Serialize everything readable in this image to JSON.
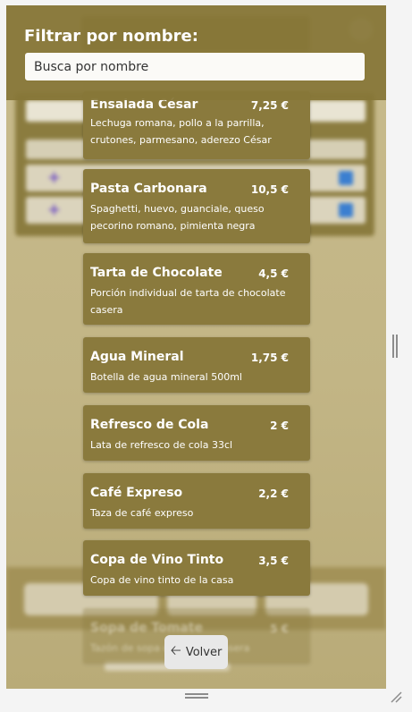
{
  "filter": {
    "label": "Filtrar por nombre:",
    "placeholder": "Busca por nombre",
    "value": ""
  },
  "menu_items": [
    {
      "name": "Ensalada César",
      "price": "7,25 €",
      "description": "Lechuga romana, pollo a la parrilla, crutones, parmesano, aderezo César"
    },
    {
      "name": "Pasta Carbonara",
      "price": "10,5 €",
      "description": "Spaghetti, huevo, guanciale, queso pecorino romano, pimienta negra"
    },
    {
      "name": "Tarta de Chocolate",
      "price": "4,5 €",
      "description": "Porción individual de tarta de chocolate casera"
    },
    {
      "name": "Agua Mineral",
      "price": "1,75 €",
      "description": "Botella de agua mineral 500ml"
    },
    {
      "name": "Refresco de Cola",
      "price": "2 €",
      "description": "Lata de refresco de cola 33cl"
    },
    {
      "name": "Café Expreso",
      "price": "2,2 €",
      "description": "Taza de café expreso"
    },
    {
      "name": "Copa de Vino Tinto",
      "price": "3,5 €",
      "description": "Copa de vino tinto de la casa"
    },
    {
      "name": "Sopa de Tomate",
      "price": "5 €",
      "description": "Tazón de sopa de tomate casera"
    }
  ],
  "back_button": {
    "label": "Volver",
    "icon": "arrow-left-icon"
  },
  "colors": {
    "card": "#8a7a3d",
    "header": "#867638",
    "background": "#c8bb8c"
  }
}
